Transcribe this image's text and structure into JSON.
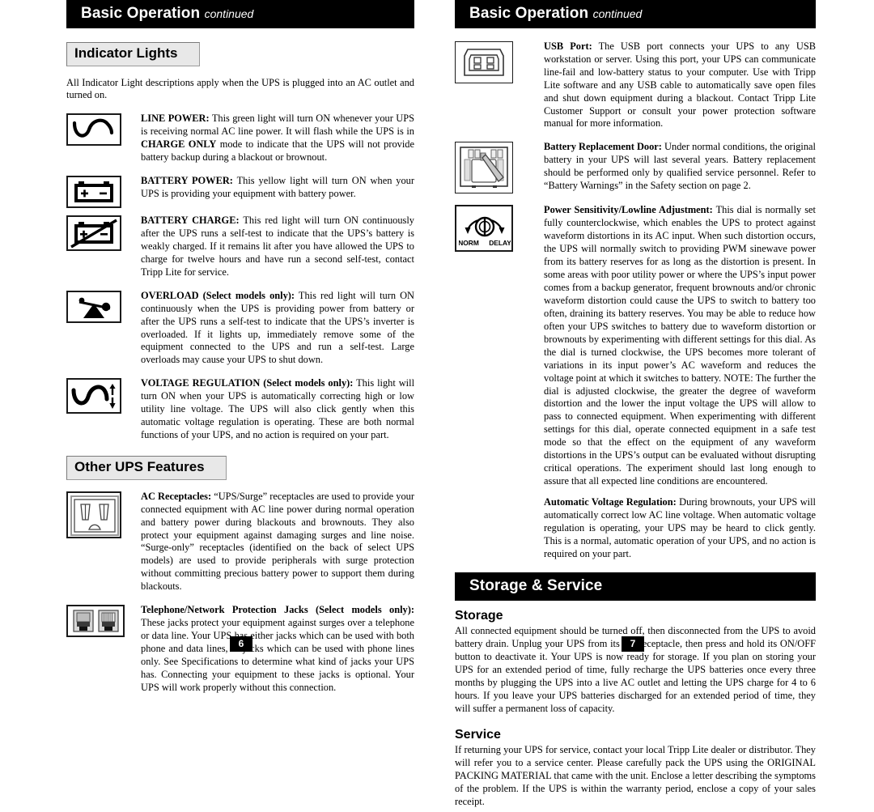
{
  "left_page": {
    "banner": {
      "title": "Basic Operation",
      "continued": "continued"
    },
    "section1_heading": "Indicator Lights",
    "intro": "All Indicator Light descriptions apply when the UPS is plugged into an AC outlet and turned on.",
    "indicators": [
      {
        "icon": "sine-wave-icon",
        "term": "LINE POWER:",
        "body": " This green light will turn ON whenever your UPS is receiving normal AC line power. It will flash while the UPS is in CHARGE ONLY mode to indicate that the UPS will not provide battery backup during a blackout or brownout.",
        "emphasis": "CHARGE ONLY"
      },
      {
        "icon": "battery-icon",
        "term": "BATTERY POWER:",
        "body": " This yellow light will turn ON when your UPS is providing your equipment with battery power."
      },
      {
        "icon": "battery-slashed-icon",
        "term": "BATTERY CHARGE:",
        "body": " This red light will turn ON continuously after the UPS runs a self-test to indicate that the UPS’s battery is weakly charged. If it remains lit after you have allowed the UPS to charge for twelve hours and have run a second self-test, contact Tripp Lite for service."
      },
      {
        "icon": "overload-seesaw-icon",
        "term": "OVERLOAD (Select models only):",
        "body": " This red light will turn ON continuously when the UPS is providing power from battery or after the UPS runs a self-test to indicate that the UPS’s inverter is overloaded. If it lights up, immediately remove some of the equipment connected to the UPS and run a self-test. Large overloads may cause your UPS to shut down."
      },
      {
        "icon": "voltage-regulation-icon",
        "term": "VOLTAGE REGULATION (Select models only):",
        "body": " This light will turn ON when your UPS is automatically correcting high or low utility line voltage. The UPS will also click gently when this automatic voltage regulation is operating. These are both normal functions of your UPS, and no action is required on your part."
      }
    ],
    "section2_heading": "Other UPS Features",
    "features": [
      {
        "icon": "ac-receptacle-icon",
        "term": "AC Receptacles:",
        "body": " “UPS/Surge” receptacles are used to provide your connected equipment with AC line power during normal operation and battery power during blackouts and brownouts. They also protect your equipment against damaging surges and line noise. “Surge-only” receptacles (identified on the back of select UPS models) are used to provide peripherals with surge protection without committing precious battery power to support them during blackouts."
      },
      {
        "icon": "telephone-jack-icon",
        "term": "Telephone/Network Protection Jacks (Select models only):",
        "body": " These jacks protect your equipment against surges over a telephone or data line. Your UPS has either jacks which can be used with both phone and data lines, or jacks which can be used with phone lines only. See Specifications to determine what kind of jacks your UPS has. Connecting your equipment to these jacks is optional. Your UPS will work properly without this connection."
      }
    ],
    "page_number": "6"
  },
  "right_page": {
    "banner": {
      "title": "Basic Operation",
      "continued": "continued"
    },
    "features": [
      {
        "icon": "usb-port-icon",
        "term": "USB Port:",
        "body": " The USB port connects your UPS to any USB workstation or server. Using this port, your UPS can communicate line-fail and low-battery status to your computer. Use with Tripp Lite software and any USB cable to automatically save open files and shut down equipment during a blackout. Contact Tripp Lite Customer Support or consult your power protection software manual for more information."
      },
      {
        "icon": "battery-door-icon",
        "term": "Battery Replacement Door:",
        "body": " Under normal conditions, the original battery in your UPS will last several years. Battery replacement should be performed only by qualified service personnel. Refer to “Battery Warnings” in the Safety section on page 2."
      },
      {
        "icon": "power-sensitivity-dial-icon",
        "icon_labels": {
          "left": "NORM",
          "right": "DELAY"
        },
        "term": "Power Sensitivity/Lowline Adjustment:",
        "body": " This dial is normally set fully counterclockwise, which enables the UPS to protect against waveform distortions in its AC input. When such distortion occurs, the UPS will normally switch to providing PWM sinewave power from its battery reserves for as long as the distortion is present. In some areas with poor utility power or where the UPS’s input power comes from a backup generator, frequent brownouts and/or chronic waveform distortion could cause the UPS to switch to battery too often, draining its battery reserves. You may be able to reduce how often your UPS switches to battery due to waveform distortion or brownouts by experimenting with different settings for this dial. As the dial is turned clockwise, the UPS becomes more tolerant of variations in its input power’s AC waveform and reduces the voltage point at which it switches to battery. NOTE: The further the dial is adjusted clockwise, the greater the degree of waveform distortion and the lower the input voltage the UPS will allow to pass to connected equipment. When experimenting with different settings for this dial, operate connected equipment in a safe test mode so that the effect on the equipment of any waveform distortions in the UPS’s output can be evaluated without disrupting critical operations. The experiment should last long enough to assure that all expected line conditions are encountered."
      },
      {
        "icon": "none",
        "term": "Automatic Voltage Regulation:",
        "body": " During brownouts, your UPS will automatically correct low AC line voltage. When automatic voltage regulation is operating, your UPS may be heard to click gently. This is a normal, automatic operation of your UPS, and no action is required on your part."
      }
    ],
    "storage_banner": "Storage & Service",
    "storage_heading": "Storage",
    "storage_body": "All connected equipment should be turned off, then disconnected from the UPS to avoid battery drain. Unplug your UPS from its AC receptacle, then press and hold its ON/OFF button to deactivate it. Your UPS is now ready for storage. If you plan on storing your UPS for an extended period of time, fully recharge the UPS batteries once every three months by plugging the UPS into a live AC outlet and letting the UPS charge for 4 to 6 hours. If you leave your UPS batteries discharged for an extended period of time, they will suffer a permanent loss of capacity.",
    "service_heading": "Service",
    "service_body": "If returning your UPS for service, contact your local Tripp Lite dealer or distributor. They will refer you to a service center. Please carefully pack the UPS using the ORIGINAL PACKING MATERIAL that came with the unit. Enclose a letter describing the symptoms of the problem. If the UPS is within the warranty period, enclose a copy of your sales receipt.",
    "page_number": "7"
  },
  "colors": {
    "banner_bg": "#000000",
    "banner_text": "#ffffff",
    "subhead_bg": "#e8e8e8",
    "subhead_border": "#7a7a7a",
    "body_text": "#000000"
  }
}
